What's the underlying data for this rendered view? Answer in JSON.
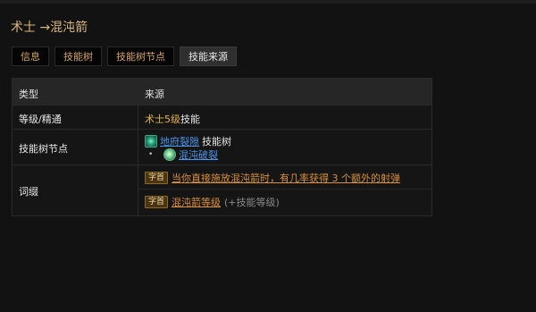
{
  "header": {
    "title": "术士 →混沌箭"
  },
  "tabs": [
    {
      "label": "信息",
      "active": false
    },
    {
      "label": "技能树",
      "active": false
    },
    {
      "label": "技能树节点",
      "active": false
    },
    {
      "label": "技能来源",
      "active": true
    }
  ],
  "table": {
    "columns": [
      "类型",
      "来源"
    ],
    "rows": {
      "level": {
        "type": "等级/精通",
        "class_level": "术士5级",
        "suffix": "技能"
      },
      "tree_node": {
        "type": "技能树节点",
        "skill_icon": "rift-skill-icon",
        "skill_name": "地府裂隙",
        "skill_suffix": "技能树",
        "bullet": "•",
        "node_icon": "chaos-node-icon",
        "node_name": "混沌破裂"
      },
      "affix": {
        "type": "词缀",
        "items": [
          {
            "badge": "字首",
            "text": "当你直接施放混沌箭时，有几率获得 3 个额外的射弹",
            "note": ""
          },
          {
            "badge": "字首",
            "text": "混沌箭等级",
            "note": "(+技能等级)"
          }
        ]
      }
    }
  },
  "colors": {
    "background": "#121212",
    "gold": "#e3b352",
    "orange_link": "#d9903a",
    "blue_link": "#4a94e8",
    "title": "#d8b57a"
  }
}
